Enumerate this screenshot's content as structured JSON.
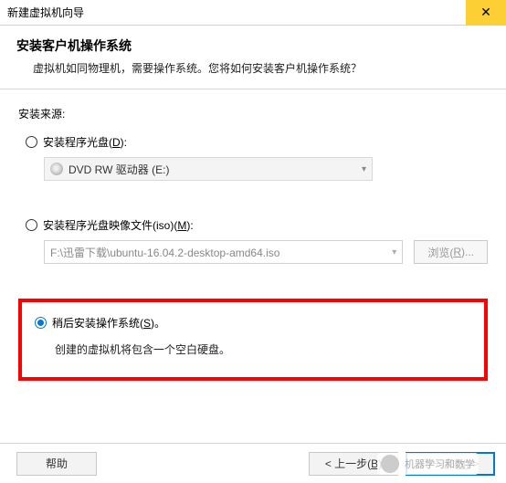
{
  "titlebar": {
    "title": "新建虚拟机向导"
  },
  "header": {
    "title": "安装客户机操作系统",
    "subtitle": "虚拟机如同物理机，需要操作系统。您将如何安装客户机操作系统？"
  },
  "source_label": "安装来源:",
  "option_disc": {
    "label_pre": "安装程序光盘(",
    "mn": "D",
    "label_post": "):",
    "dropdown_text": "DVD RW 驱动器 (E:)"
  },
  "option_iso": {
    "label_pre": "安装程序光盘映像文件(iso)(",
    "mn": "M",
    "label_post": "):",
    "path": "F:\\迅雷下载\\ubuntu-16.04.2-desktop-amd64.iso",
    "browse_pre": "浏览(",
    "browse_mn": "R",
    "browse_post": ")..."
  },
  "option_later": {
    "label_pre": "稍后安装操作系统(",
    "mn": "S",
    "label_post": ")。",
    "note": "创建的虚拟机将包含一个空白硬盘。"
  },
  "footer": {
    "help": "帮助",
    "back_pre": "< 上一步(",
    "back_mn": "B",
    "back_post": ")",
    "next_pre": "下一步(",
    "next_mn": "N",
    "next_post": ") >"
  },
  "watermark": "机器学习和数学"
}
